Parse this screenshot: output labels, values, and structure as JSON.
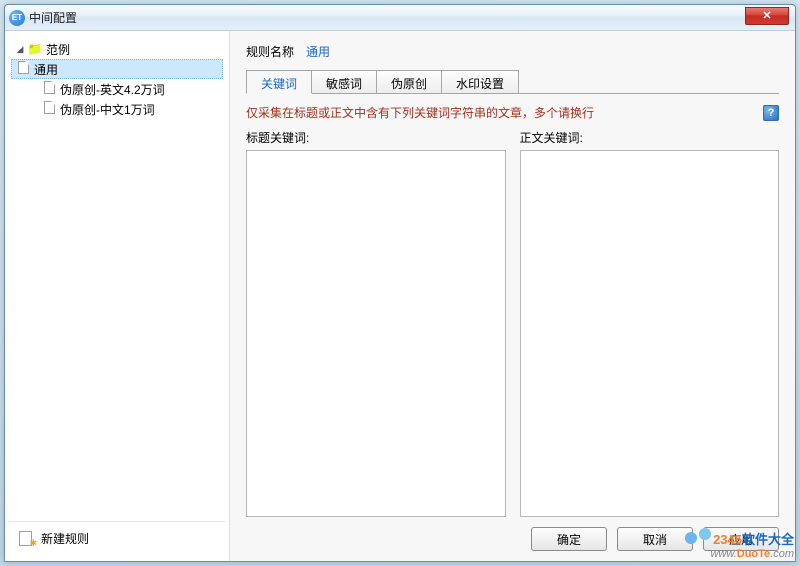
{
  "titlebar": {
    "icon_text": "ET",
    "title": "中间配置",
    "close_glyph": "✕"
  },
  "sidebar": {
    "root": {
      "label": "范例"
    },
    "items": [
      {
        "label": "通用",
        "selected": true
      },
      {
        "label": "伪原创-英文4.2万词",
        "selected": false
      },
      {
        "label": "伪原创-中文1万词",
        "selected": false
      }
    ],
    "new_rule_label": "新建规则"
  },
  "main": {
    "rule_name_label": "规则名称",
    "rule_name_value": "通用",
    "tabs": [
      {
        "label": "关键词",
        "active": true
      },
      {
        "label": "敏感词",
        "active": false
      },
      {
        "label": "伪原创",
        "active": false
      },
      {
        "label": "水印设置",
        "active": false
      }
    ],
    "hint": "仅采集在标题或正文中含有下列关键词字符串的文章，多个请换行",
    "help_glyph": "?",
    "title_keywords_label": "标题关键词:",
    "body_keywords_label": "正文关键词:",
    "title_keywords_value": "",
    "body_keywords_value": ""
  },
  "buttons": {
    "ok": "确定",
    "cancel": "取消",
    "apply": "应用"
  },
  "watermark": {
    "line1_brand": "2345",
    "line1_rest": "软件大全",
    "line2_pre": "www.",
    "line2_mid": "DuoTe",
    "line2_post": ".com"
  }
}
